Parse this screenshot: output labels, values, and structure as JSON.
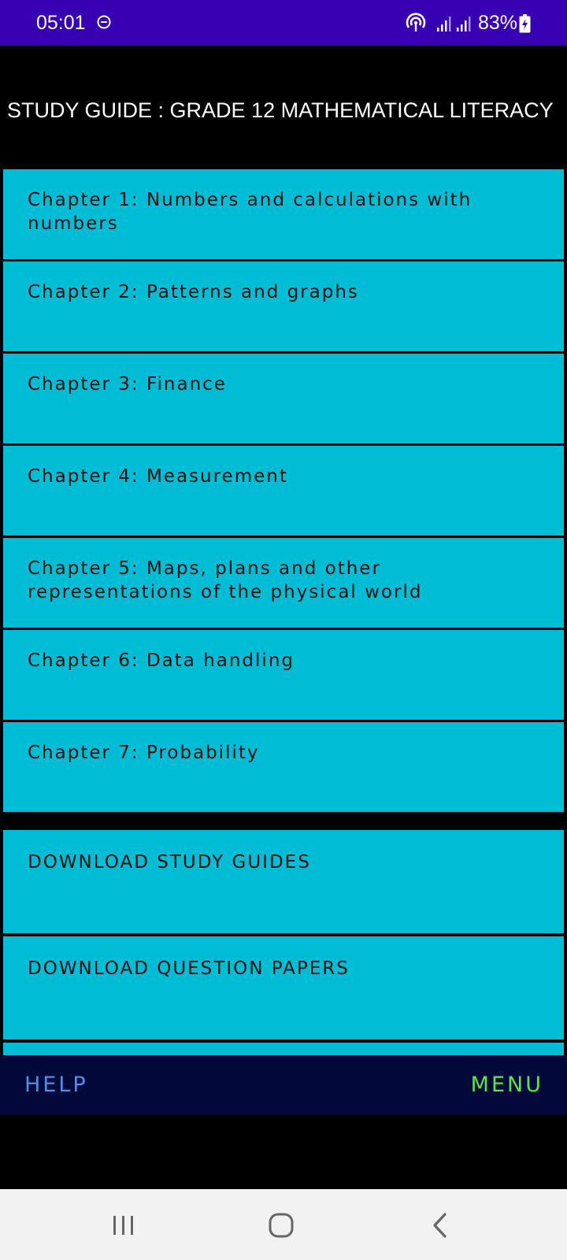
{
  "status_bar": {
    "time": "05:01",
    "battery_text": "83%",
    "icons": [
      "do-not-disturb-icon",
      "hotspot-icon",
      "signal-icon",
      "signal-icon",
      "battery-charging-icon"
    ]
  },
  "page": {
    "title": "STUDY GUIDE : GRADE 12 MATHEMATICAL LITERACY"
  },
  "chapters": [
    {
      "label": "Chapter 1: Numbers and calculations with numbers"
    },
    {
      "label": "Chapter 2: Patterns and graphs"
    },
    {
      "label": "Chapter 3: Finance"
    },
    {
      "label": "Chapter 4: Measurement"
    },
    {
      "label": "Chapter 5: Maps, plans and other representations of the physical world"
    },
    {
      "label": "Chapter 6: Data handling"
    },
    {
      "label": "Chapter 7: Probability"
    }
  ],
  "downloads": [
    {
      "label": "DOWNLOAD STUDY GUIDES"
    },
    {
      "label": "DOWNLOAD QUESTION PAPERS"
    }
  ],
  "bottom_bar": {
    "help_label": "HELP",
    "menu_label": "MENU"
  },
  "nav_bar": {
    "icons": [
      "recents-icon",
      "home-icon",
      "back-icon"
    ]
  },
  "colors": {
    "status_bar": "#3800b3",
    "item_background": "#00bcd4",
    "bottom_bar": "#000a3a",
    "help": "#4f8fe8",
    "menu": "#5be54a",
    "nav_bar": "#f2f2f2"
  }
}
